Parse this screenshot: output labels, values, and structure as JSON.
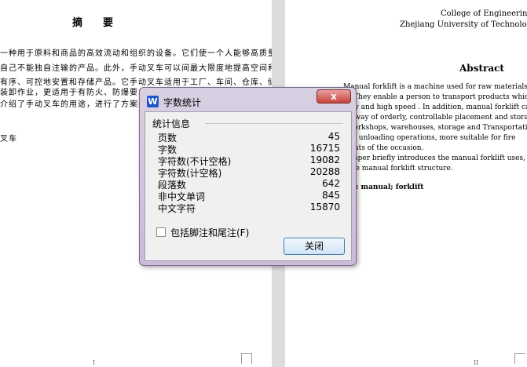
{
  "document": {
    "zh_title": "摘要",
    "zh_lines": [
      "一种用于原料和商品的高效流动和组织的设备。它们使一个人能够高质量",
      "自己不能独自注输的产品。此外，手动叉车可以间最大限度地提高空间和",
      "有序、可控地安置和存储产品。它手动叉车适用于工厂、车间、仓库、储",
      "装卸作业，更适用于有防火、防爆要求的场合。",
      "介绍了手动叉车的用途，进行了方案的设计",
      "叉车"
    ],
    "en_college": "College of Engineering",
    "en_university": "Zhejiang University of Technology",
    "en_abstract_title": "Abstract",
    "en_lines": [
      "Manual forklift is a machine used for raw materials and",
      "ty. They enable a person to transport products which t",
      "ality and high speed  . In addition, manual forklift can",
      "ng way of orderly, controllable placement and storag",
      ", workshops, warehouses, storage and Transportation",
      " and unloading operations, more suitable for fire",
      "ments of the occasion.",
      "s paper briefly introduces the manual forklift uses, the d",
      "f the manual forklift structure.",
      "rds: manual; forklift"
    ],
    "page_num_left": "I",
    "page_num_right": "II"
  },
  "dialog": {
    "title": "字数统计",
    "icon_letter": "W",
    "close_x": "x",
    "group_title": "统计信息",
    "stats": [
      {
        "label": "页数",
        "value": "45"
      },
      {
        "label": "字数",
        "value": "16715"
      },
      {
        "label": "字符数(不计空格)",
        "value": "19082"
      },
      {
        "label": "字符数(计空格)",
        "value": "20288"
      },
      {
        "label": "段落数",
        "value": "642"
      },
      {
        "label": "非中文单词",
        "value": "845"
      },
      {
        "label": "中文字符",
        "value": "15870"
      }
    ],
    "checkbox_label": "包括脚注和尾注(F)",
    "close_button": "关闭"
  }
}
